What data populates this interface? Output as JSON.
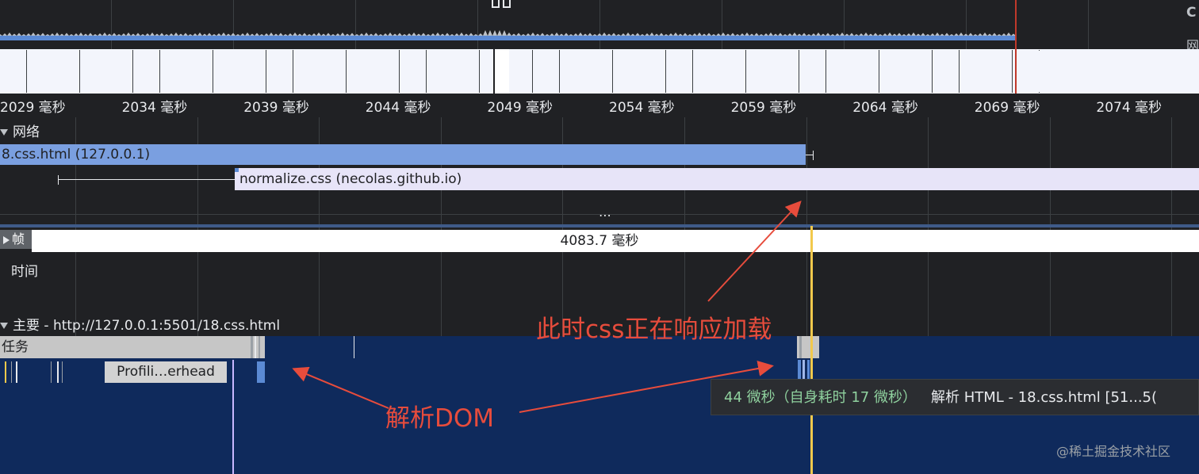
{
  "overview": {
    "right_label_top": "C",
    "right_label_bottom": "网"
  },
  "ruler": {
    "ticks": [
      "2029 毫秒",
      "2034 毫秒",
      "2039 毫秒",
      "2044 毫秒",
      "2049 毫秒",
      "2054 毫秒",
      "2059 毫秒",
      "2064 毫秒",
      "2069 毫秒",
      "2074 毫秒"
    ]
  },
  "network": {
    "header": "网络",
    "requests": [
      {
        "label": "8.css.html (127.0.0.1)"
      },
      {
        "label": "normalize.css (necolas.github.io)"
      }
    ]
  },
  "frames": {
    "label": "帧",
    "value": "4083.7 毫秒"
  },
  "timings": {
    "label": "时间"
  },
  "main": {
    "header": "主要 - http://127.0.0.1:5501/18.css.html",
    "task_label": "任务",
    "profiling_label": "Profili…erhead"
  },
  "tooltip": {
    "time": "44 微秒（自身耗时 17 微秒）",
    "event": "解析 HTML - 18.css.html [51...5("
  },
  "annotations": {
    "css_loading": "此时css正在响应加载",
    "parse_dom": "解析DOM"
  },
  "watermark": "@稀土掘金技术社区",
  "colors": {
    "annotation": "#e74c3c",
    "html_request": "#7a9fe0",
    "css_request": "#e7e4f8",
    "flame_bg": "#0f2a5c",
    "selection_line": "#f2c94c"
  }
}
